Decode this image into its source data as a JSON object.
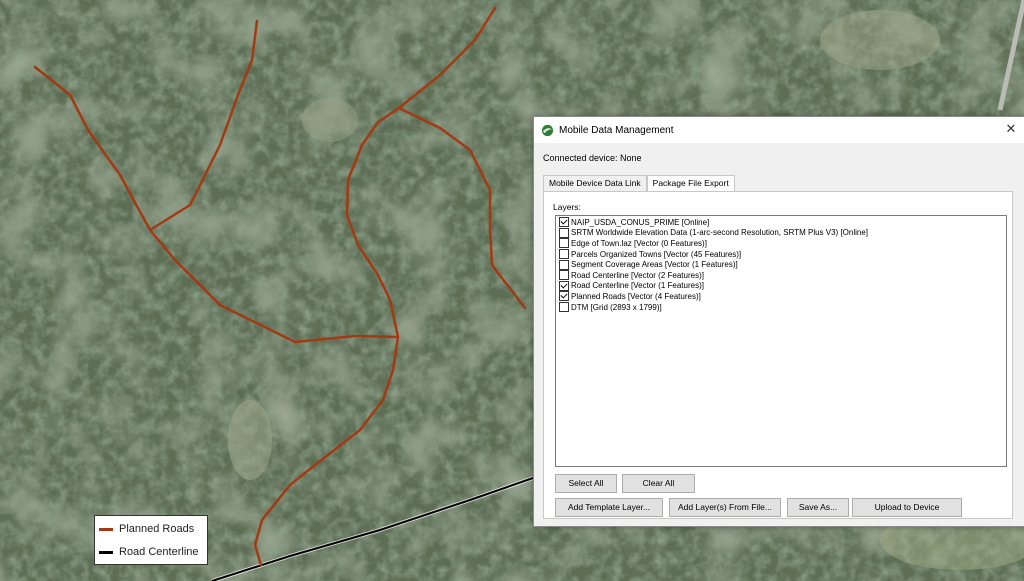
{
  "legend": {
    "items": [
      {
        "label": "Planned Roads",
        "color": "#a23a13"
      },
      {
        "label": "Road Centerline",
        "color": "#000000"
      }
    ]
  },
  "dialog": {
    "title": "Mobile Data Management",
    "connected_label": "Connected device: None",
    "tabs": [
      {
        "label": "Mobile Device Data Link",
        "active": false
      },
      {
        "label": "Package File Export",
        "active": true
      }
    ],
    "layers_label": "Layers:",
    "layers": [
      {
        "label": "NAIP_USDA_CONUS_PRIME [Online]",
        "checked": true
      },
      {
        "label": "SRTM Worldwide Elevation Data (1-arc-second Resolution, SRTM Plus V3) [Online]",
        "checked": false
      },
      {
        "label": "Edge of Town.laz [Vector (0 Features)]",
        "checked": false
      },
      {
        "label": "Parcels Organized Towns [Vector (45 Features)]",
        "checked": false
      },
      {
        "label": "Segment Coverage Areas [Vector (1 Features)]",
        "checked": false
      },
      {
        "label": "Road Centerline [Vector (2 Features)]",
        "checked": false
      },
      {
        "label": "Road Centerline [Vector (1 Features)]",
        "checked": true
      },
      {
        "label": "Planned Roads [Vector (4 Features)]",
        "checked": true
      },
      {
        "label": "DTM [Grid (2893 x 1799)]",
        "checked": false
      }
    ],
    "select_all": "Select All",
    "clear_all": "Clear All",
    "add_template": "Add Template Layer...",
    "add_from_file": "Add Layer(s) From File...",
    "save_as": "Save As...",
    "upload": "Upload to Device"
  }
}
